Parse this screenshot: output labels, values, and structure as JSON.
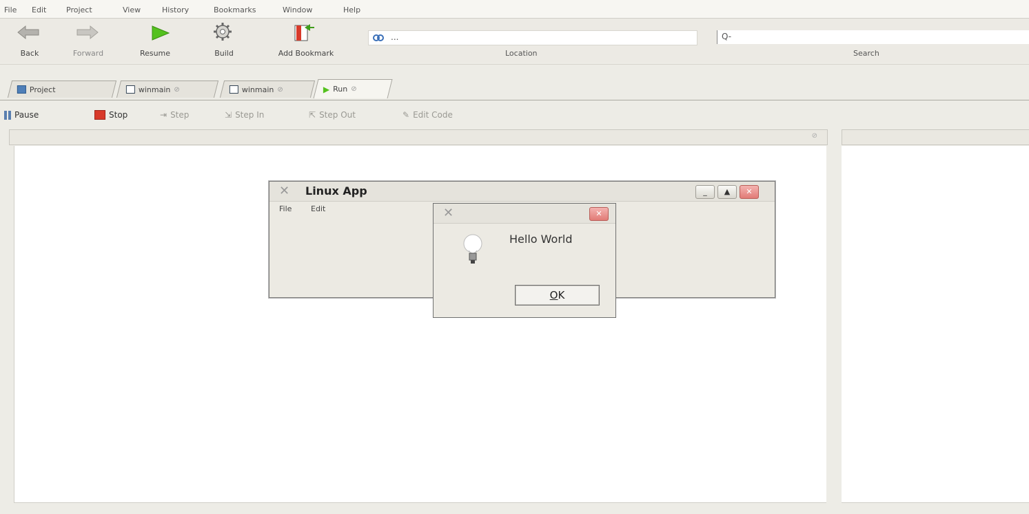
{
  "menubar": [
    "File",
    "Edit",
    "Project",
    "View",
    "History",
    "Bookmarks",
    "Window",
    "Help"
  ],
  "toolbar": {
    "back": "Back",
    "forward": "Forward",
    "resume": "Resume",
    "build": "Build",
    "add_bookmark": "Add Bookmark",
    "location_value": "...",
    "location_label": "Location",
    "search_label": "Search",
    "search_glyph": "Q-"
  },
  "tabs": [
    {
      "label": "Project"
    },
    {
      "label": "winmain"
    },
    {
      "label": "winmain"
    },
    {
      "label": "Run",
      "active": true
    }
  ],
  "debug_toolbar": {
    "pause": "Pause",
    "stop": "Stop",
    "step": "Step",
    "step_in": "Step In",
    "step_out": "Step Out",
    "edit_code": "Edit Code"
  },
  "app_window": {
    "title": "Linux App",
    "menu": [
      "File",
      "Edit"
    ]
  },
  "dialog": {
    "message": "Hello World",
    "ok_mnemonic": "O",
    "ok_rest": "K"
  },
  "colors": {
    "accent_green": "#54c11e",
    "stop_red": "#d83a2a",
    "close_red": "#e27b76"
  }
}
